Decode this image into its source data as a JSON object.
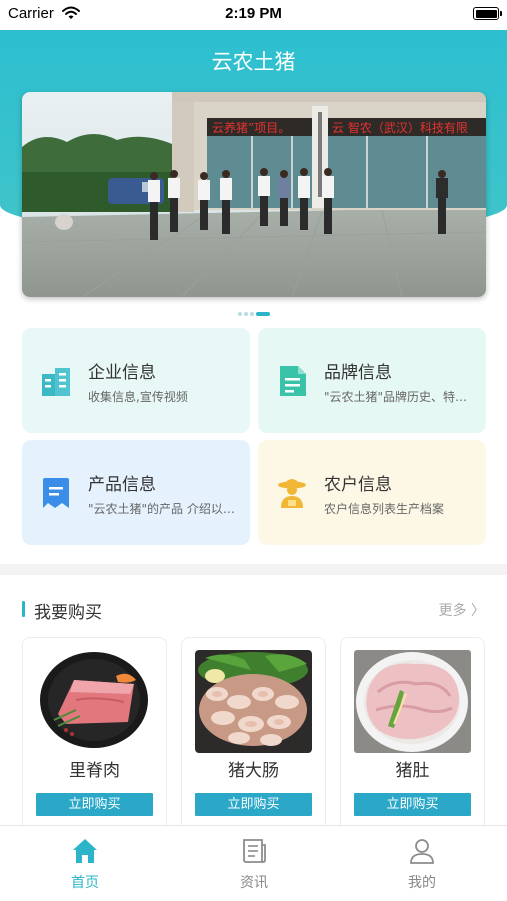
{
  "status_bar": {
    "carrier": "Carrier",
    "time": "2:19 PM"
  },
  "header": {
    "title": "云农土猪"
  },
  "banner": {
    "sign_left": "云养猪”项目。",
    "sign_right": "云 智农（武汉）科技有限",
    "dot_count": 4,
    "active_dot": 3
  },
  "quick_cards": [
    {
      "title": "企业信息",
      "subtitle": "收集信息,宣传视频",
      "icon": "building-icon",
      "color": "#3bb8c6"
    },
    {
      "title": "品牌信息",
      "subtitle": "\"云农土猪\"品牌历史、特色等等",
      "icon": "document-icon",
      "color": "#39c3a8"
    },
    {
      "title": "产品信息",
      "subtitle": "\"云农土猪\"的产品 介绍以及信息",
      "icon": "bookmark-doc-icon",
      "color": "#3a8ee8"
    },
    {
      "title": "农户信息",
      "subtitle": "农户信息列表生产档案",
      "icon": "farmer-icon",
      "color": "#f1b634"
    }
  ],
  "purchase_section": {
    "title": "我要购买",
    "more_label": "更多 〉",
    "products": [
      {
        "name": "里脊肉",
        "buy_label": "立即购买"
      },
      {
        "name": "猪大肠",
        "buy_label": "立即购买"
      },
      {
        "name": "猪肚",
        "buy_label": "立即购买"
      }
    ]
  },
  "tabbar": {
    "tabs": [
      {
        "label": "首页",
        "icon": "home-icon",
        "active": true
      },
      {
        "label": "资讯",
        "icon": "news-icon",
        "active": false
      },
      {
        "label": "我的",
        "icon": "user-icon",
        "active": false
      }
    ]
  },
  "colors": {
    "accent": "#2cb4c8",
    "button": "#2ba8c8"
  }
}
